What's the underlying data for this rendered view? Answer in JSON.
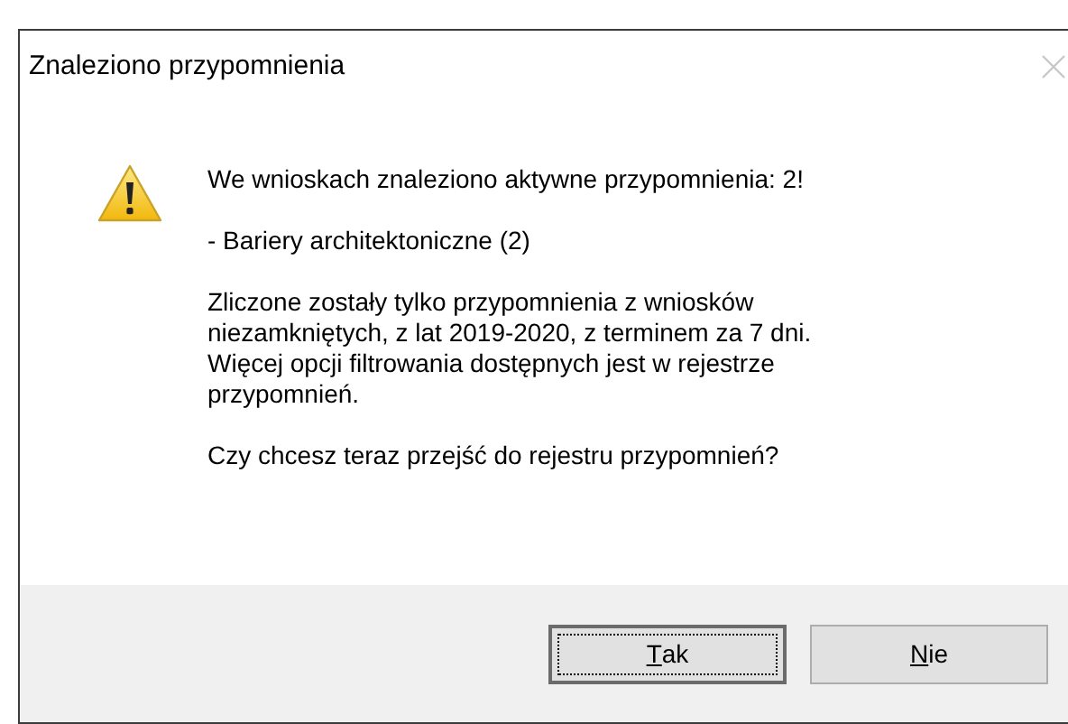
{
  "window": {
    "title": "Znaleziono przypomnienia"
  },
  "message": {
    "paragraphs": [
      [
        "We wnioskach znaleziono aktywne przypomnienia: 2!"
      ],
      [
        "- Bariery architektoniczne (2)"
      ],
      [
        "Zliczone zostały tylko przypomnienia z wniosków",
        "niezamkniętych, z lat 2019-2020, z terminem za 7 dni.",
        "Więcej opcji filtrowania dostępnych jest w rejestrze",
        "przypomnień."
      ],
      [
        "Czy chcesz teraz przejść do rejestru przypomnień?"
      ]
    ]
  },
  "buttons": [
    {
      "label": "Tak",
      "default": true
    },
    {
      "label": "Nie",
      "default": false
    }
  ]
}
